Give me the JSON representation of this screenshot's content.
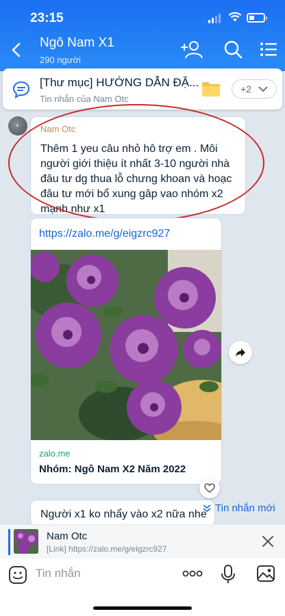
{
  "status": {
    "time": "23:15"
  },
  "header": {
    "title": "Ngô Nam X1",
    "members": "290 người"
  },
  "pinned": {
    "title": "[Thư mục] HƯỚNG DẪN ĐẶ...",
    "subtitle": "Tin nhắn của Nam Otc",
    "more_label": "+2"
  },
  "messages": [
    {
      "sender": "Nam Otc",
      "text": "Thêm 1 yeu câu nhỏ hô trợ em . Môi người giới thiệu ít nhất 3-10 người nhà đâu tư dg thua lỗ chưng khoan và hoạc đâu tư mới bổ xung gâp vao nhóm x2 mạnh như x1"
    },
    {
      "link_url": "https://zalo.me/g/eigzrc927",
      "domain": "zalo.me",
      "group_name": "Nhóm: Ngô Nam X2 Năm 2022"
    },
    {
      "text": "Người x1 ko nhẩy vào x2 nữa nhe"
    }
  ],
  "new_messages_label": "Tin nhắn mới",
  "reply": {
    "name": "Nam Otc",
    "link": "[Link] https://zalo.me/g/eigzrc927"
  },
  "composer": {
    "placeholder": "Tin nhắn"
  },
  "colors": {
    "header_blue": "#1b6ff2",
    "link_blue": "#1565d8",
    "annotation_red": "#c8282a",
    "sender_orange": "#c08a55"
  }
}
